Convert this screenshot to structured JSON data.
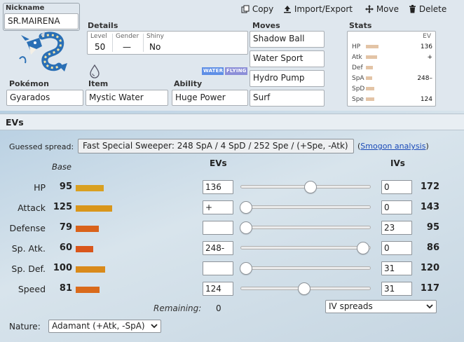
{
  "nickname": {
    "label": "Nickname",
    "value": "SR.MAIRENA"
  },
  "actions": {
    "copy": "Copy",
    "import_export": "Import/Export",
    "move": "Move",
    "delete": "Delete"
  },
  "details": {
    "heading": "Details",
    "level_label": "Level",
    "level": "50",
    "gender_label": "Gender",
    "gender": "—",
    "shiny_label": "Shiny",
    "shiny": "No"
  },
  "types": [
    "WATER",
    "FLYING"
  ],
  "type_colors": {
    "WATER": "#5f8fe6",
    "FLYING": "#8c8fd8"
  },
  "pokemon": {
    "label": "Pokémon",
    "value": "Gyarados"
  },
  "item": {
    "label": "Item",
    "value": "Mystic Water"
  },
  "ability": {
    "label": "Ability",
    "value": "Huge Power"
  },
  "moves": {
    "heading": "Moves",
    "list": [
      "Shadow Ball",
      "Water Sport",
      "Hydro Pump",
      "Surf"
    ]
  },
  "stats_box": {
    "heading": "Stats",
    "ev_label": "EV",
    "rows": [
      {
        "name": "HP",
        "ev": "136"
      },
      {
        "name": "Atk",
        "ev": "+"
      },
      {
        "name": "Def",
        "ev": ""
      },
      {
        "name": "SpA",
        "ev": "248–"
      },
      {
        "name": "SpD",
        "ev": ""
      },
      {
        "name": "Spe",
        "ev": "124"
      }
    ]
  },
  "evs_section": {
    "heading": "EVs",
    "guessed_label": "Guessed spread:",
    "guessed_value": "Fast Special Sweeper: 248 SpA / 4 SpD / 252 Spe / (+Spe, -Atk)",
    "smogon_link": "Smogon analysis",
    "paren_open": "(",
    "paren_close": ")",
    "col_base": "Base",
    "col_evs": "EVs",
    "col_ivs": "IVs",
    "stats": [
      {
        "name": "HP",
        "base": "95",
        "ev": "136",
        "iv": "0",
        "total": "172",
        "bar_color": "#d9a021",
        "ev_fraction": 0.54
      },
      {
        "name": "Attack",
        "base": "125",
        "ev": "+",
        "iv": "0",
        "total": "143",
        "bar_color": "#d9961b",
        "ev_fraction": 0
      },
      {
        "name": "Defense",
        "base": "79",
        "ev": "",
        "iv": "23",
        "total": "95",
        "bar_color": "#d9621b",
        "ev_fraction": 0
      },
      {
        "name": "Sp. Atk.",
        "base": "60",
        "ev": "248-",
        "iv": "0",
        "total": "86",
        "bar_color": "#d9561b",
        "ev_fraction": 0.98
      },
      {
        "name": "Sp. Def.",
        "base": "100",
        "ev": "",
        "iv": "31",
        "total": "120",
        "bar_color": "#d98a1b",
        "ev_fraction": 0
      },
      {
        "name": "Speed",
        "base": "81",
        "ev": "124",
        "iv": "31",
        "total": "117",
        "bar_color": "#d96a1b",
        "ev_fraction": 0.49
      }
    ],
    "remaining_label": "Remaining:",
    "remaining_value": "0",
    "iv_spreads": "IV spreads",
    "nature_label": "Nature:",
    "nature_value": "Adamant (+Atk, -SpA)"
  }
}
